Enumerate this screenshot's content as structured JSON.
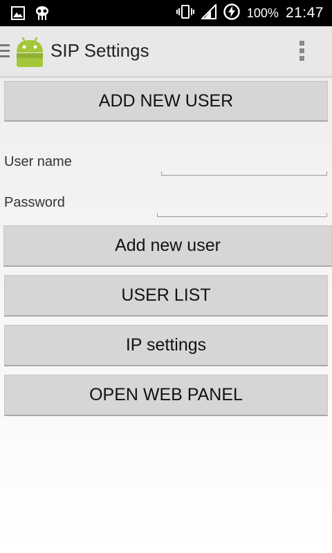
{
  "status_bar": {
    "battery_percent": "100%",
    "time": "21:47",
    "icons": [
      "gallery-icon",
      "cyanogen-icon",
      "vibrate-icon",
      "signal-icon",
      "charging-icon"
    ]
  },
  "action_bar": {
    "title": "SIP Settings",
    "icons": [
      "drawer-icon",
      "android-app-icon",
      "overflow-menu-icon"
    ]
  },
  "main": {
    "add_new_user_header_button": "ADD NEW USER",
    "username_label": "User name",
    "username_value": "",
    "password_label": "Password",
    "password_value": "",
    "add_user_button": "Add new user",
    "user_list_button": "USER LIST",
    "ip_settings_button": "IP settings",
    "open_web_panel_button": "OPEN WEB PANEL"
  },
  "colors": {
    "status_bar_bg": "#000000",
    "action_bar_bg": "#e8e8e8",
    "button_bg": "#d6d6d6",
    "android_green": "#a4c639"
  }
}
